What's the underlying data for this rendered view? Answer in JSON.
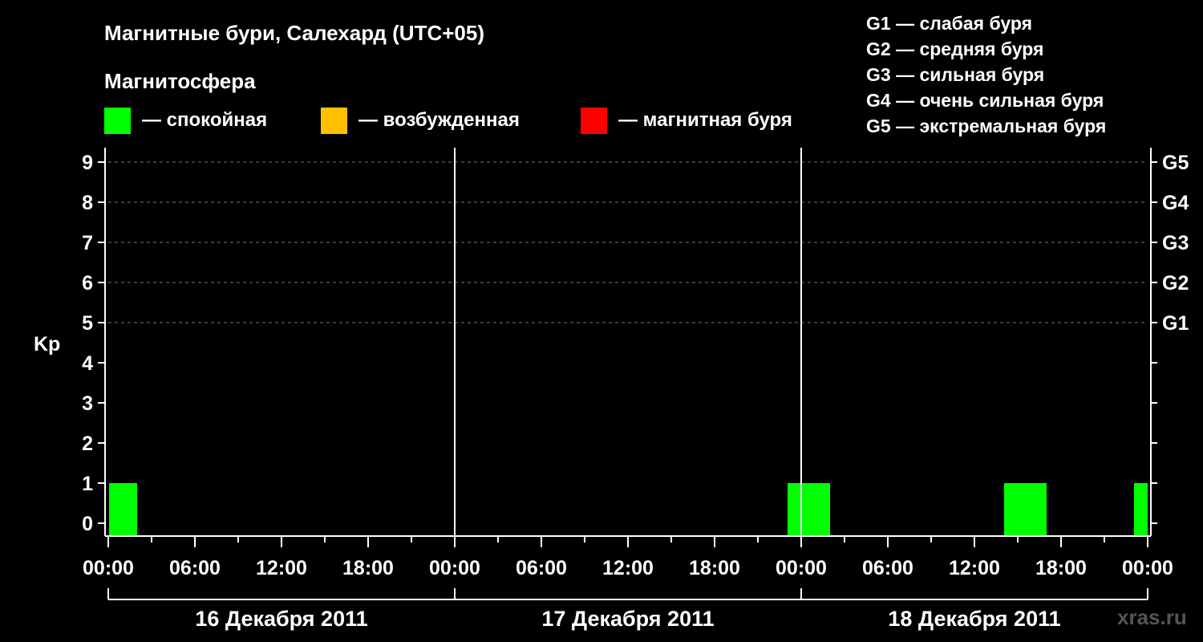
{
  "chart_data": {
    "type": "bar",
    "title": "Магнитные бури, Салехард (UTC+05)",
    "legend_title": "Магнитосфера",
    "legend": [
      {
        "label": "— спокойная",
        "color": "#00ff00"
      },
      {
        "label": "— возбужденная",
        "color": "#ffc000"
      },
      {
        "label": "— магнитная буря",
        "color": "#ff0000"
      }
    ],
    "storm_levels": [
      "G1 — слабая буря",
      "G2 — средняя буря",
      "G3 — сильная буря",
      "G4 — очень сильная буря",
      "G5 — экстремальная буря"
    ],
    "ylabel": "Kp",
    "ylim": [
      0,
      9
    ],
    "y_ticks": [
      0,
      1,
      2,
      3,
      4,
      5,
      6,
      7,
      8,
      9
    ],
    "right_ticks": [
      {
        "kp": 5,
        "label": "G1"
      },
      {
        "kp": 6,
        "label": "G2"
      },
      {
        "kp": 7,
        "label": "G3"
      },
      {
        "kp": 8,
        "label": "G4"
      },
      {
        "kp": 9,
        "label": "G5"
      }
    ],
    "x_tick_labels": [
      "00:00",
      "06:00",
      "12:00",
      "18:00",
      "00:00",
      "06:00",
      "12:00",
      "18:00",
      "00:00",
      "06:00",
      "12:00",
      "18:00",
      "00:00"
    ],
    "dates": [
      "16 Декабря 2011",
      "17 Декабря 2011",
      "18 Декабря 2011"
    ],
    "bars": [
      {
        "start": "2011-12-16 00:00",
        "end": "2011-12-16 02:00",
        "kp": 1,
        "color": "#00ff00"
      },
      {
        "start": "2011-12-17 23:00",
        "end": "2011-12-18 02:00",
        "kp": 1,
        "color": "#00ff00"
      },
      {
        "start": "2011-12-18 14:00",
        "end": "2011-12-18 17:00",
        "kp": 1,
        "color": "#00ff00"
      },
      {
        "start": "2011-12-18 23:00",
        "end": "2011-12-19 00:00",
        "kp": 1,
        "color": "#00ff00"
      }
    ],
    "grid": true,
    "watermark": "xras.ru"
  }
}
